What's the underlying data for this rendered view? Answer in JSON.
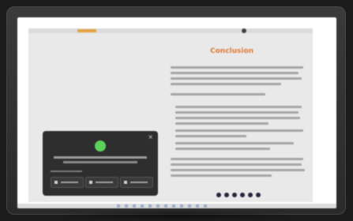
{
  "document": {
    "title": "Conclusion"
  },
  "overlay": {
    "close_glyph": "×",
    "accent": "#5bd25b"
  },
  "colors": {
    "doc_title": "#e07b39",
    "tab_highlight": "#e7a445"
  },
  "icons": {
    "close": "close-icon",
    "status": "success-icon"
  }
}
